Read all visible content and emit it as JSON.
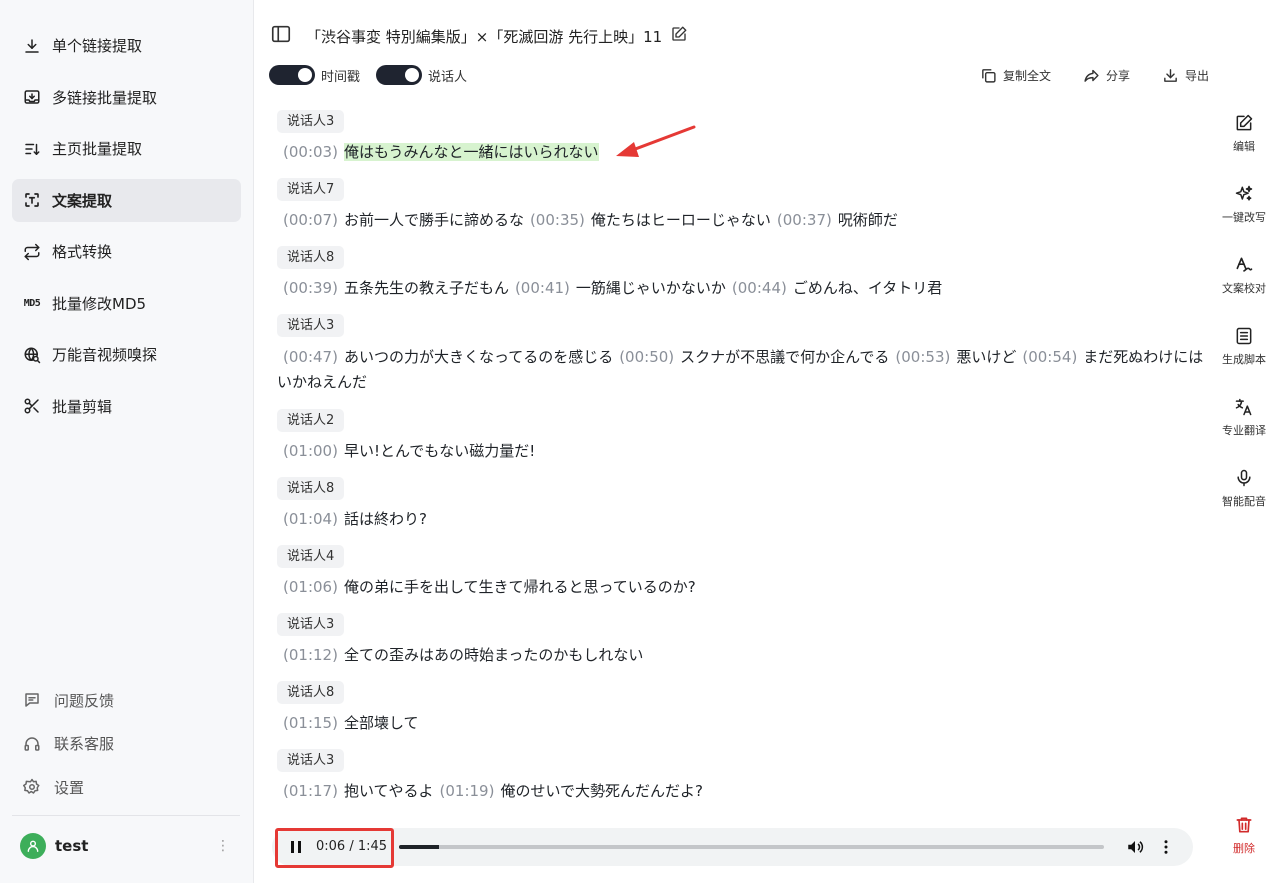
{
  "sidebar": {
    "items": [
      {
        "label": "单个链接提取",
        "icon": "download-icon",
        "active": false
      },
      {
        "label": "多链接批量提取",
        "icon": "inbox-download-icon",
        "active": false
      },
      {
        "label": "主页批量提取",
        "icon": "list-sort-icon",
        "active": false
      },
      {
        "label": "文案提取",
        "icon": "text-scan-icon",
        "active": true
      },
      {
        "label": "格式转换",
        "icon": "repeat-icon",
        "active": false
      },
      {
        "label": "批量修改MD5",
        "icon": "md5-icon",
        "active": false
      },
      {
        "label": "万能音视频嗅探",
        "icon": "globe-search-icon",
        "active": false
      },
      {
        "label": "批量剪辑",
        "icon": "scissors-icon",
        "active": false
      }
    ],
    "md5_icon_text": "MD5",
    "bottom": [
      {
        "label": "问题反馈",
        "icon": "feedback-icon"
      },
      {
        "label": "联系客服",
        "icon": "headset-icon"
      },
      {
        "label": "设置",
        "icon": "gear-icon"
      }
    ],
    "user": {
      "name": "test",
      "more": "⋮"
    }
  },
  "header": {
    "title": "「渋谷事変 特別編集版」×「死滅回游 先行上映」11"
  },
  "toolbar": {
    "timestamp_label": "时间戳",
    "speaker_label": "说话人",
    "timestamp_on": true,
    "speaker_on": true,
    "copy_label": "复制全文",
    "share_label": "分享",
    "export_label": "导出"
  },
  "transcript": [
    {
      "speaker": "说话人3",
      "parts": [
        {
          "ts": "(00:03)",
          "text": "俺はもうみんなと一緒にはいられない",
          "highlight": true
        }
      ]
    },
    {
      "speaker": "说话人7",
      "parts": [
        {
          "ts": "(00:07)",
          "text": "お前一人で勝手に諦めるな"
        },
        {
          "ts": "(00:35)",
          "text": "俺たちはヒーローじゃない"
        },
        {
          "ts": "(00:37)",
          "text": "呪術師だ"
        }
      ]
    },
    {
      "speaker": "说话人8",
      "parts": [
        {
          "ts": "(00:39)",
          "text": "五条先生の教え子だもん"
        },
        {
          "ts": "(00:41)",
          "text": "一筋縄じゃいかないか"
        },
        {
          "ts": "(00:44)",
          "text": "ごめんね、イタトリ君"
        }
      ]
    },
    {
      "speaker": "说话人3",
      "parts": [
        {
          "ts": "(00:47)",
          "text": "あいつの力が大きくなってるのを感じる"
        },
        {
          "ts": "(00:50)",
          "text": "スクナが不思議で何か企んでる"
        },
        {
          "ts": "(00:53)",
          "text": "悪いけど"
        },
        {
          "ts": "(00:54)",
          "text": "まだ死ぬわけにはいかねえんだ"
        }
      ]
    },
    {
      "speaker": "说话人2",
      "parts": [
        {
          "ts": "(01:00)",
          "text": "早い!とんでもない磁力量だ!"
        }
      ]
    },
    {
      "speaker": "说话人8",
      "parts": [
        {
          "ts": "(01:04)",
          "text": "話は終わり?"
        }
      ]
    },
    {
      "speaker": "说话人4",
      "parts": [
        {
          "ts": "(01:06)",
          "text": "俺の弟に手を出して生きて帰れると思っているのか?"
        }
      ]
    },
    {
      "speaker": "说话人3",
      "parts": [
        {
          "ts": "(01:12)",
          "text": "全ての歪みはあの時始まったのかもしれない"
        }
      ]
    },
    {
      "speaker": "说话人8",
      "parts": [
        {
          "ts": "(01:15)",
          "text": "全部壊して"
        }
      ]
    },
    {
      "speaker": "说话人3",
      "parts": [
        {
          "ts": "(01:17)",
          "text": "抱いてやるよ"
        },
        {
          "ts": "(01:19)",
          "text": "俺のせいで大勢死んだんだよ?"
        }
      ]
    }
  ],
  "rail": [
    {
      "label": "编辑",
      "icon": "edit-icon"
    },
    {
      "label": "一键改写",
      "icon": "sparkle-icon"
    },
    {
      "label": "文案校对",
      "icon": "proofread-icon"
    },
    {
      "label": "生成脚本",
      "icon": "script-icon"
    },
    {
      "label": "专业翻译",
      "icon": "translate-icon"
    },
    {
      "label": "智能配音",
      "icon": "microphone-icon"
    }
  ],
  "delete_label": "删除",
  "player": {
    "time": "0:06 / 1:45",
    "progress": 0.0571,
    "state": "playing"
  },
  "colors": {
    "highlight": "#d7f3cf",
    "annotation_red": "#e53935",
    "toggle_on": "#1f2430",
    "avatar": "#3dae5a",
    "delete": "#d12b2b"
  }
}
